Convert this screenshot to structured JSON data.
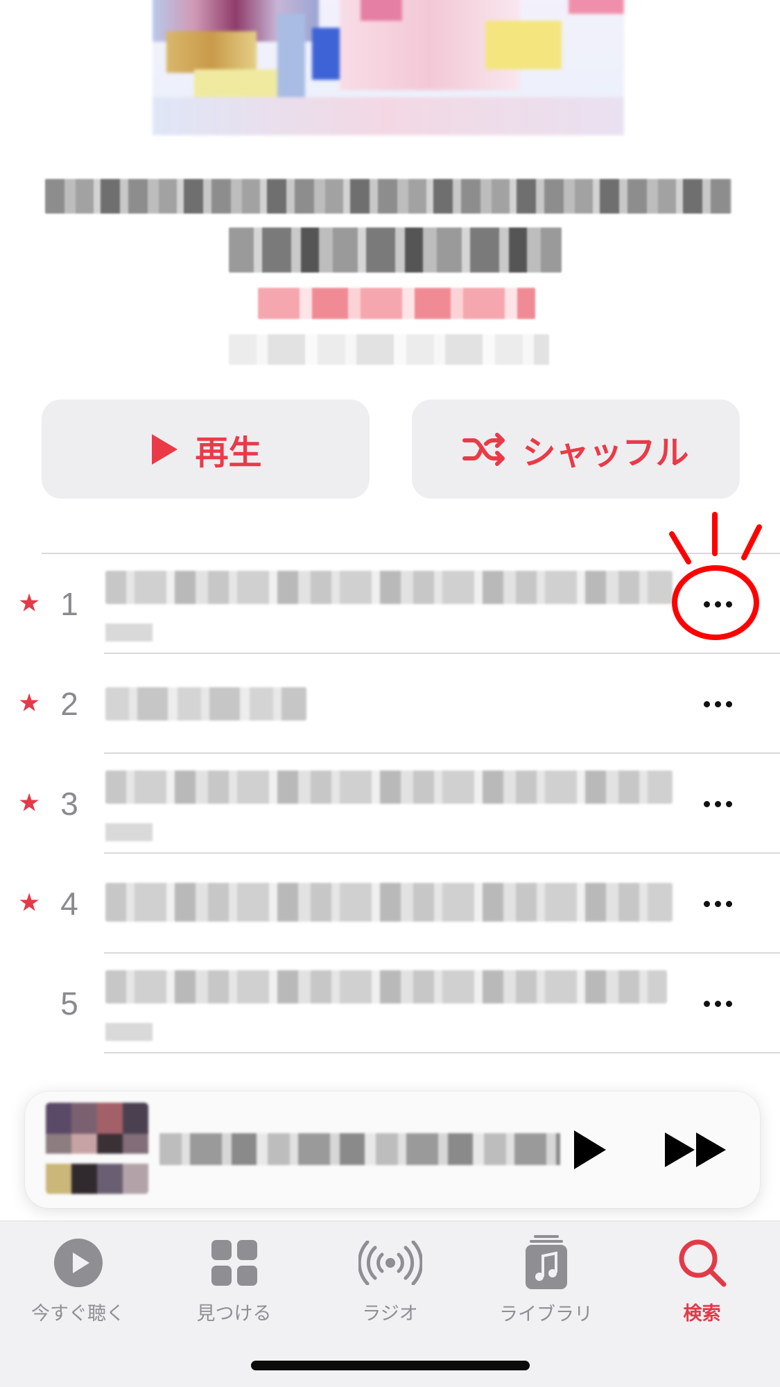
{
  "actions": {
    "play_label": "再生",
    "shuffle_label": "シャッフル"
  },
  "tracks": [
    {
      "number": "1",
      "starred": true
    },
    {
      "number": "2",
      "starred": true
    },
    {
      "number": "3",
      "starred": true
    },
    {
      "number": "4",
      "starred": true
    },
    {
      "number": "5",
      "starred": false
    }
  ],
  "star_glyph": "★",
  "tab_bar": {
    "items": [
      {
        "label": "今すぐ聴く",
        "icon": "play-circle-icon",
        "active": false
      },
      {
        "label": "見つける",
        "icon": "grid-icon",
        "active": false
      },
      {
        "label": "ラジオ",
        "icon": "radio-broadcast-icon",
        "active": false
      },
      {
        "label": "ライブラリ",
        "icon": "music-library-icon",
        "active": false
      },
      {
        "label": "検索",
        "icon": "search-icon",
        "active": true
      }
    ]
  },
  "colors": {
    "accent": "#e33a48",
    "button_bg": "#eeeef0",
    "inactive": "#8e8e93",
    "annotation": "#ff0000"
  }
}
